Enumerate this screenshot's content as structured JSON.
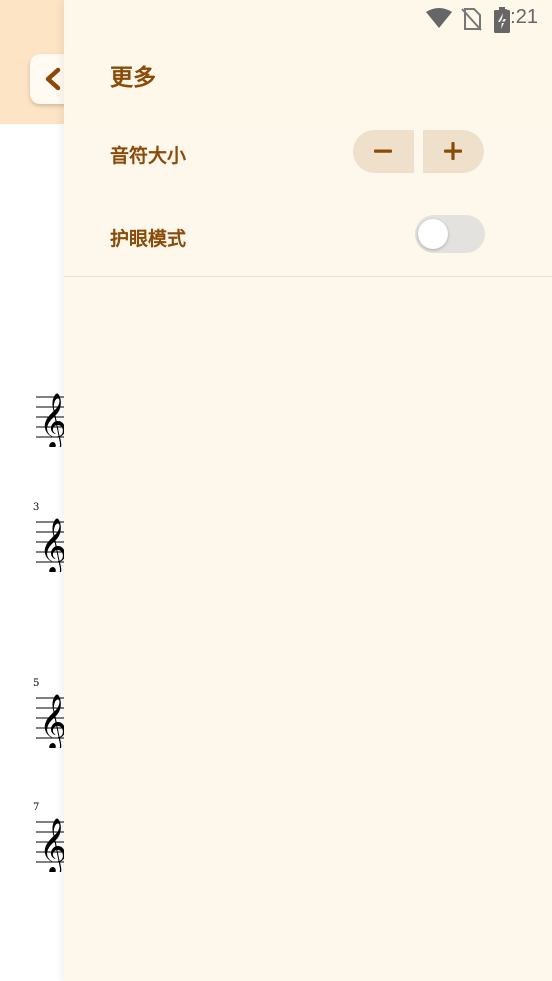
{
  "status_bar": {
    "time": "2:21",
    "icons": [
      "wifi-icon",
      "no-sim-icon",
      "battery-charging-icon"
    ]
  },
  "sheet": {
    "measure_numbers": [
      "3",
      "5",
      "7"
    ],
    "back_icon": "chevron-left-icon"
  },
  "drawer": {
    "title": "更多",
    "note_size": {
      "label": "音符大小",
      "decrease_icon": "minus-icon",
      "increase_icon": "plus-icon"
    },
    "eye_care": {
      "label": "护眼模式",
      "enabled": false
    }
  },
  "colors": {
    "accent": "#8a4a08",
    "header_bg": "#fde4c4",
    "drawer_bg": "#fdf7ec",
    "stepper_bg": "#efe0cb",
    "toggle_off": "#e4e2de"
  }
}
